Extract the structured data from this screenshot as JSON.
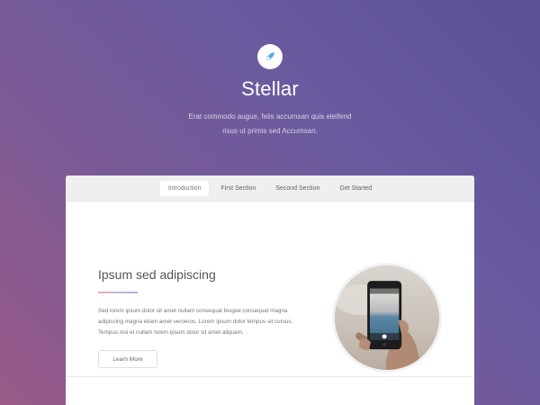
{
  "header": {
    "logo_icon": "rocket-icon",
    "title": "Stellar",
    "tagline_line1": "Erat commodo augue, felis accumsan quis eleifend",
    "tagline_line2": "risus ut primis sed Accumsan."
  },
  "nav": {
    "items": [
      {
        "label": "Introduction",
        "active": true
      },
      {
        "label": "First Section",
        "active": false
      },
      {
        "label": "Second Section",
        "active": false
      },
      {
        "label": "Get Started",
        "active": false
      }
    ]
  },
  "intro": {
    "title": "Ipsum sed adipiscing",
    "body_line1": "Sed lorem ipsum dolor sit amet nullam consequat feugiat consequat magna",
    "body_line2": "adipiscing magna etiam amet veroeros. Lorem ipsum dolor tempus sit cursus.",
    "body_line3": "Tempus nisl et nullam lorem ipsum dolor sit amet aliquam.",
    "button_label": "Learn More",
    "image_description_icon": "phone-photo-image"
  },
  "colors": {
    "accent_icon": "#5aa9e6",
    "bg_top_right": "#5b4f98",
    "bg_bottom_left": "#9a5a88"
  }
}
